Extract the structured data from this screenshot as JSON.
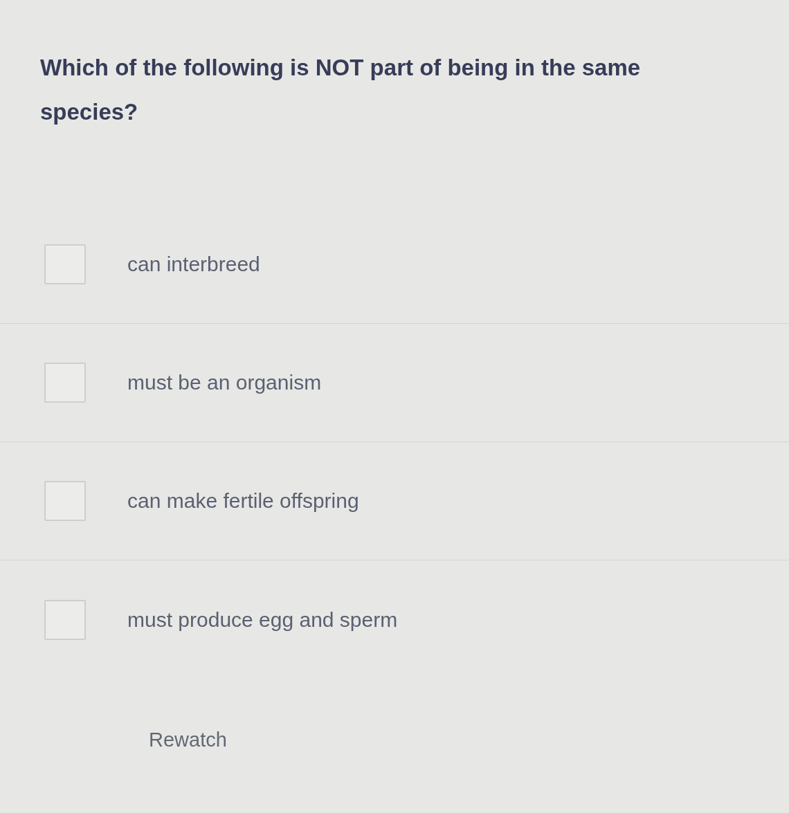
{
  "question": {
    "text": "Which of the following is NOT part of being in the same species?"
  },
  "options": [
    {
      "label": "can interbreed",
      "checked": false
    },
    {
      "label": "must be an organism",
      "checked": false
    },
    {
      "label": "can make fertile offspring",
      "checked": false
    },
    {
      "label": "must produce egg and sperm",
      "checked": false
    }
  ],
  "buttons": [
    {
      "label": "Rewatch"
    }
  ]
}
